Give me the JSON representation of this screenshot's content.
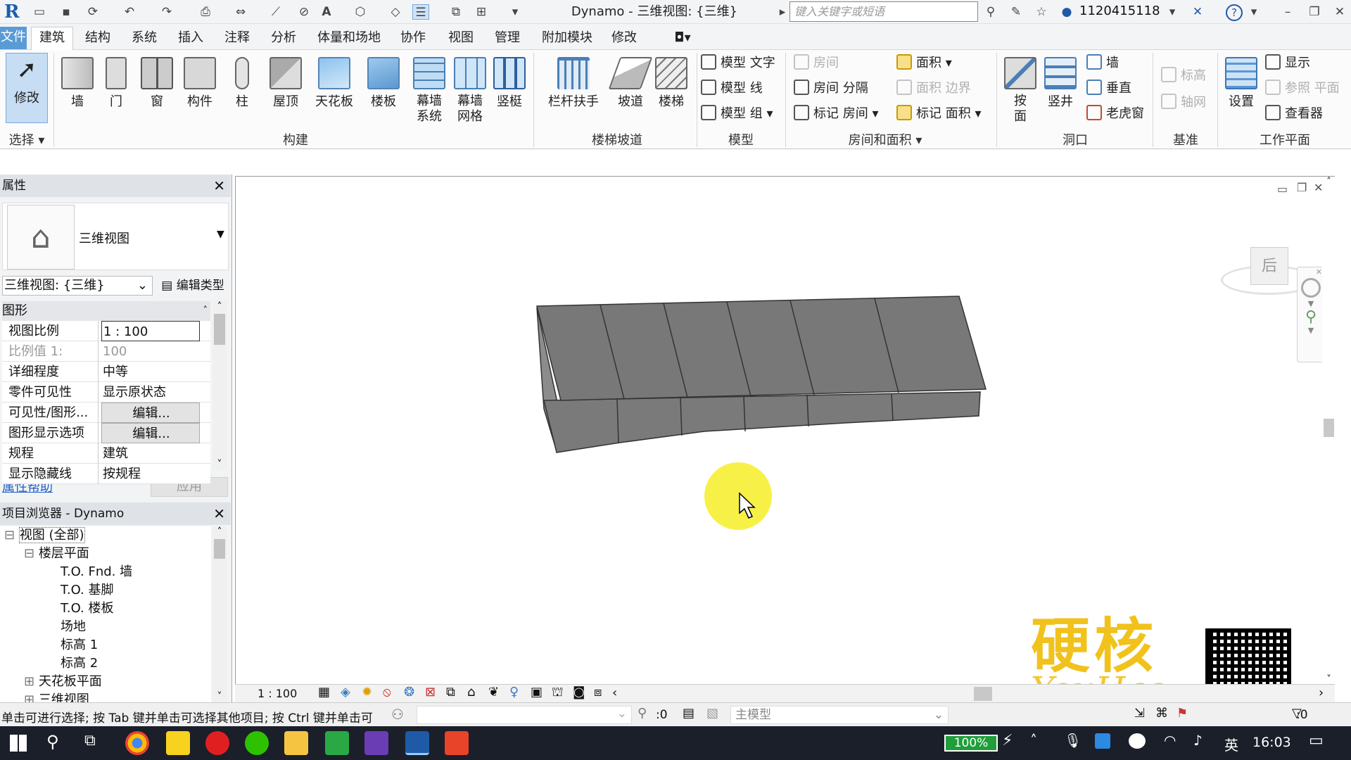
{
  "app": {
    "logo": "R",
    "title": "Dynamo - 三维视图: {三维}",
    "search_placeholder": "键入关键字或短语",
    "user": "1120415118",
    "help": "?"
  },
  "menu": [
    "文件",
    "建筑",
    "结构",
    "系统",
    "插入",
    "注释",
    "分析",
    "体量和场地",
    "协作",
    "视图",
    "管理",
    "附加模块",
    "修改"
  ],
  "ribbon": {
    "select": {
      "modify": "修改",
      "group": "选择"
    },
    "build": {
      "items": [
        "墙",
        "门",
        "窗",
        "构件",
        "柱",
        "屋顶",
        "天花板",
        "楼板",
        "幕墙\n系统",
        "幕墙\n网格",
        "竖梃"
      ],
      "group": "构建"
    },
    "stairs": {
      "items": [
        "栏杆扶手",
        "坡道",
        "楼梯"
      ],
      "group": "楼梯坡道"
    },
    "model": {
      "items": [
        "模型 文字",
        "模型 线",
        "模型 组"
      ],
      "group": "模型"
    },
    "rooms": {
      "col1": [
        "房间",
        "房间 分隔",
        "标记 房间"
      ],
      "col2": [
        "面积",
        "面积 边界",
        "标记 面积"
      ],
      "group": "房间和面积"
    },
    "opening": {
      "items": [
        "按\n面",
        "竖井"
      ],
      "small": [
        "墙",
        "垂直",
        "老虎窗"
      ],
      "group": "洞口"
    },
    "datum": {
      "items": [
        "标高",
        "轴网"
      ],
      "group": "基准"
    },
    "workplane": {
      "set": "设置",
      "items": [
        "显示",
        "参照 平面",
        "查看器"
      ],
      "group": "工作平面"
    }
  },
  "properties": {
    "title": "属性",
    "type_name": "三维视图",
    "view_selector": "三维视图: {三维}",
    "edit_type": "编辑类型",
    "section": "图形",
    "rows": [
      [
        "视图比例",
        "1 : 100"
      ],
      [
        "比例值 1:",
        "100"
      ],
      [
        "详细程度",
        "中等"
      ],
      [
        "零件可见性",
        "显示原状态"
      ],
      [
        "可见性/图形...",
        "编辑..."
      ],
      [
        "图形显示选项",
        "编辑..."
      ],
      [
        "规程",
        "建筑"
      ],
      [
        "显示隐藏线",
        "按规程"
      ]
    ],
    "help": "属性帮助",
    "apply": "应用"
  },
  "browser": {
    "title": "项目浏览器 - Dynamo",
    "tree": [
      [
        "视图 (全部)",
        0
      ],
      [
        "楼层平面",
        1
      ],
      [
        "T.O. Fnd. 墙",
        2
      ],
      [
        "T.O. 基脚",
        2
      ],
      [
        "T.O. 楼板",
        2
      ],
      [
        "场地",
        2
      ],
      [
        "标高 1",
        2
      ],
      [
        "标高 2",
        2
      ],
      [
        "天花板平面",
        1
      ],
      [
        "三维视图",
        1
      ]
    ]
  },
  "viewcube": {
    "face": "后"
  },
  "view_status": {
    "scale": "1 : 100"
  },
  "status": {
    "hint": "单击可进行选择; 按 Tab 键并单击可选择其他项目; 按 Ctrl 键并单击可",
    "zero": ":0",
    "model": "主模型",
    "zero2": ":0"
  },
  "watermark": {
    "cn": "硬核",
    "en": "YouHao"
  },
  "taskbar": {
    "battery": "100%",
    "lang": "英",
    "time": "16:03"
  }
}
